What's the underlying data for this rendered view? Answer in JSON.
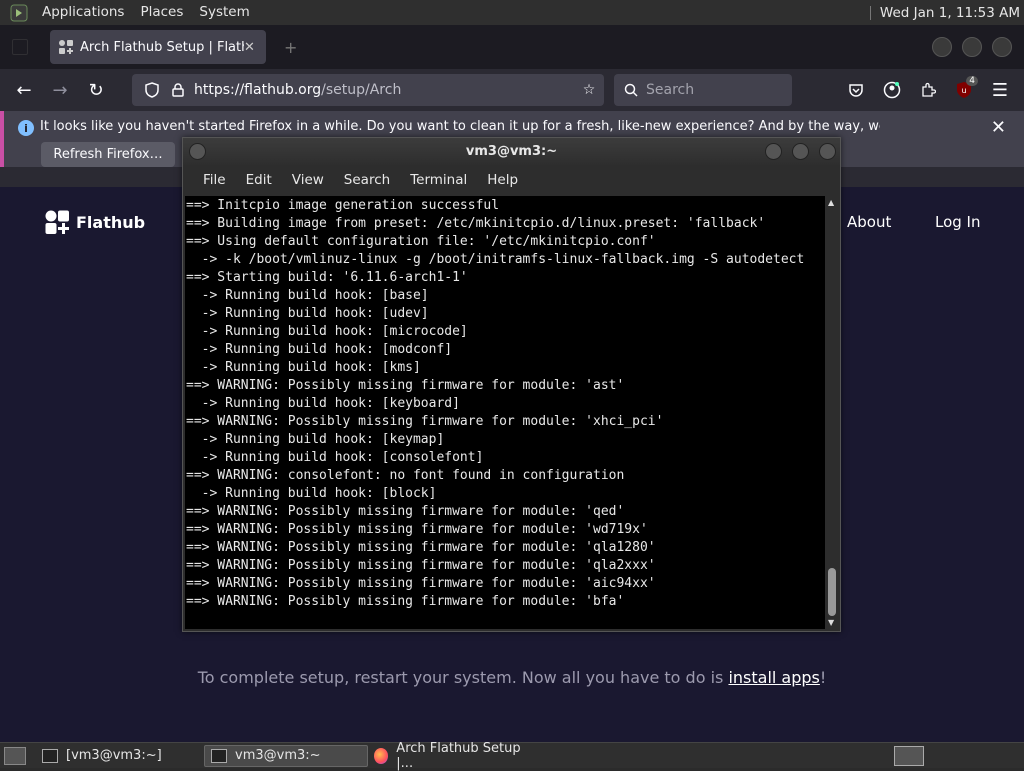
{
  "top_panel": {
    "menus": [
      "Applications",
      "Places",
      "System"
    ],
    "clock": "Wed Jan  1, 11:53 AM"
  },
  "firefox": {
    "tab_title": "Arch Flathub Setup | Flathub",
    "url_host": "https://flathub.org",
    "url_path": "/setup/Arch",
    "search_placeholder": "Search",
    "extension_badge": "4",
    "notification": {
      "message": "It looks like you haven't started Firefox in a while. Do you want to clean it up for a fresh, like-new experience? And by the way, welcome back!",
      "button": "Refresh Firefox…"
    }
  },
  "flathub": {
    "brand": "Flathub",
    "nav_about": "About",
    "nav_login": "Log In",
    "message_prefix": "To complete setup, restart your system. Now all you have to do is ",
    "message_link": "install apps",
    "message_suffix": "!"
  },
  "terminal": {
    "title": "vm3@vm3:~",
    "menu": [
      "File",
      "Edit",
      "View",
      "Search",
      "Terminal",
      "Help"
    ],
    "lines": [
      "==> Initcpio image generation successful",
      "==> Building image from preset: /etc/mkinitcpio.d/linux.preset: 'fallback'",
      "==> Using default configuration file: '/etc/mkinitcpio.conf'",
      "  -> -k /boot/vmlinuz-linux -g /boot/initramfs-linux-fallback.img -S autodetect",
      "==> Starting build: '6.11.6-arch1-1'",
      "  -> Running build hook: [base]",
      "  -> Running build hook: [udev]",
      "  -> Running build hook: [microcode]",
      "  -> Running build hook: [modconf]",
      "  -> Running build hook: [kms]",
      "==> WARNING: Possibly missing firmware for module: 'ast'",
      "  -> Running build hook: [keyboard]",
      "==> WARNING: Possibly missing firmware for module: 'xhci_pci'",
      "  -> Running build hook: [keymap]",
      "  -> Running build hook: [consolefont]",
      "==> WARNING: consolefont: no font found in configuration",
      "  -> Running build hook: [block]",
      "==> WARNING: Possibly missing firmware for module: 'qed'",
      "==> WARNING: Possibly missing firmware for module: 'wd719x'",
      "==> WARNING: Possibly missing firmware for module: 'qla1280'",
      "==> WARNING: Possibly missing firmware for module: 'qla2xxx'",
      "==> WARNING: Possibly missing firmware for module: 'aic94xx'",
      "==> WARNING: Possibly missing firmware for module: 'bfa'"
    ]
  },
  "taskbar": {
    "tasks": [
      "[vm3@vm3:~]",
      "vm3@vm3:~",
      "Arch Flathub Setup |..."
    ]
  }
}
